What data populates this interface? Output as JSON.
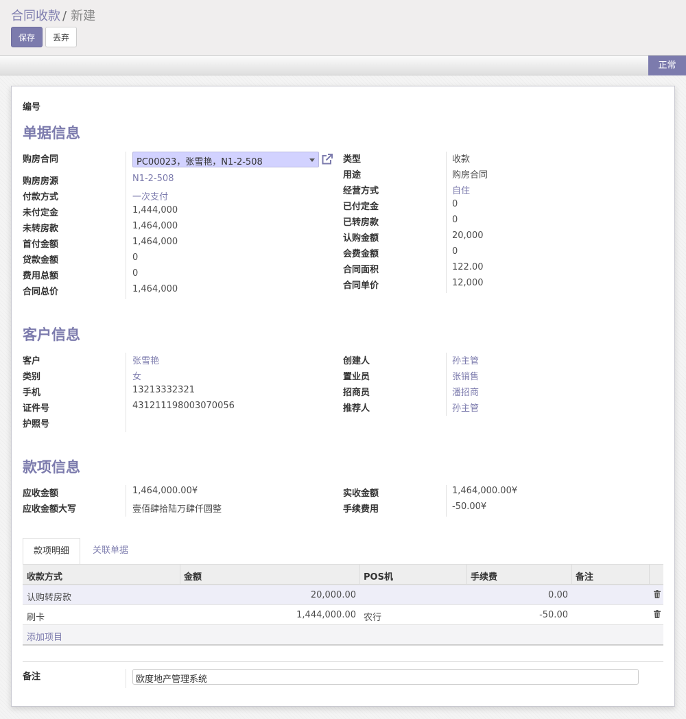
{
  "breadcrumb": {
    "parent": "合同收款",
    "separator": "/",
    "current": "新建"
  },
  "toolbar": {
    "save_label": "保存",
    "discard_label": "丢弃"
  },
  "status": {
    "label": "正常"
  },
  "form": {
    "number_label": "编号",
    "doc_section": {
      "title": "单据信息",
      "left": [
        {
          "label": "购房合同",
          "value": "PC00023，张雪艳，N1-2-508",
          "kind": "many2one"
        },
        {
          "label": "购房房源",
          "value": "N1-2-508",
          "kind": "link"
        },
        {
          "label": "付款方式",
          "value": "一次支付",
          "kind": "link"
        },
        {
          "label": "未付定金",
          "value": "1,444,000",
          "kind": "text"
        },
        {
          "label": "未转房款",
          "value": "1,464,000",
          "kind": "text"
        },
        {
          "label": "首付金额",
          "value": "1,464,000",
          "kind": "text"
        },
        {
          "label": "贷款金额",
          "value": "0",
          "kind": "text"
        },
        {
          "label": "费用总额",
          "value": "0",
          "kind": "text"
        },
        {
          "label": "合同总价",
          "value": "1,464,000",
          "kind": "text"
        }
      ],
      "right": [
        {
          "label": "类型",
          "value": "收款",
          "kind": "text"
        },
        {
          "label": "用途",
          "value": "购房合同",
          "kind": "text"
        },
        {
          "label": "经营方式",
          "value": "自住",
          "kind": "link"
        },
        {
          "label": "已付定金",
          "value": "0",
          "kind": "text"
        },
        {
          "label": "已转房款",
          "value": "0",
          "kind": "text"
        },
        {
          "label": "认购金额",
          "value": "20,000",
          "kind": "text"
        },
        {
          "label": "会费金额",
          "value": "0",
          "kind": "text"
        },
        {
          "label": "合同面积",
          "value": "122.00",
          "kind": "text"
        },
        {
          "label": "合同单价",
          "value": "12,000",
          "kind": "text"
        }
      ]
    },
    "customer_section": {
      "title": "客户信息",
      "left": [
        {
          "label": "客户",
          "value": "张雪艳",
          "kind": "link"
        },
        {
          "label": "类别",
          "value": "女",
          "kind": "link"
        },
        {
          "label": "手机",
          "value": "13213332321",
          "kind": "text"
        },
        {
          "label": "证件号",
          "value": "431211198003070056",
          "kind": "text"
        },
        {
          "label": "护照号",
          "value": "",
          "kind": "text"
        }
      ],
      "right": [
        {
          "label": "创建人",
          "value": "孙主管",
          "kind": "link"
        },
        {
          "label": "置业员",
          "value": "张销售",
          "kind": "link"
        },
        {
          "label": "招商员",
          "value": "潘招商",
          "kind": "link"
        },
        {
          "label": "推荐人",
          "value": "孙主管",
          "kind": "link"
        }
      ]
    },
    "payment_section": {
      "title": "款项信息",
      "left": [
        {
          "label": "应收金额",
          "value": "1,464,000.00¥"
        },
        {
          "label": "应收金额大写",
          "value": "壹佰肆拾陆万肆仟圆整"
        }
      ],
      "right": [
        {
          "label": "实收金额",
          "value": "1,464,000.00¥"
        },
        {
          "label": "手续费用",
          "value": "-50.00¥"
        }
      ]
    },
    "tabs": [
      {
        "label": "款项明细"
      },
      {
        "label": "关联单据"
      }
    ],
    "grid": {
      "columns": [
        "收款方式",
        "金额",
        "POS机",
        "手续费",
        "备注"
      ],
      "rows": [
        {
          "method": "认购转房款",
          "amount": "20,000.00",
          "pos": "",
          "fee": "0.00",
          "note": ""
        },
        {
          "method": "刷卡",
          "amount": "1,444,000.00",
          "pos": "农行",
          "fee": "-50.00",
          "note": ""
        }
      ],
      "add_label": "添加项目"
    },
    "note": {
      "label": "备注",
      "value": "欧度地产管理系统"
    }
  },
  "colors": {
    "accent": "#7c7bad",
    "selected_field": "#d2d2ff"
  },
  "icons": {
    "external": "external-link-icon",
    "trash": "trash-icon",
    "caret": "caret-down-icon"
  }
}
